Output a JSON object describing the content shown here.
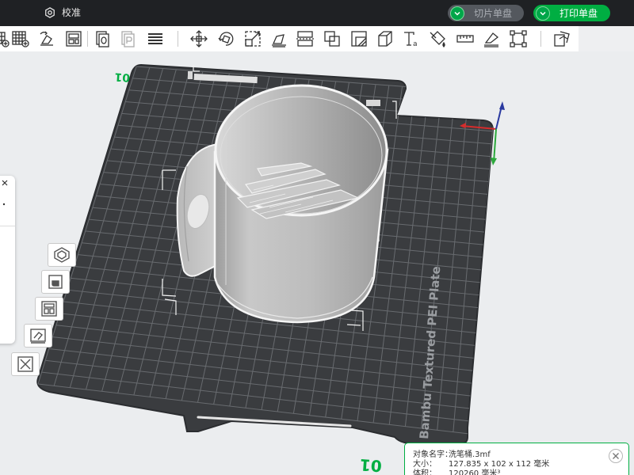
{
  "titlebar": {
    "tab_label": "校准",
    "slice_button": "切片单盘",
    "print_button": "打印单盘"
  },
  "toolbar": {
    "icons": [
      "add-object-icon",
      "add-plate-icon",
      "auto-orient-icon",
      "arrange-icon",
      "split-objects-icon",
      "split-parts-icon",
      "layers-icon",
      "move-icon",
      "rotate-icon",
      "scale-icon",
      "lay-on-face-icon",
      "cut-icon",
      "boolean-icon",
      "support-paint-icon",
      "measure-shape-icon",
      "text-icon",
      "color-paint-icon",
      "ruler-icon",
      "seam-paint-icon",
      "assembly-icon",
      "view-assembly-icon"
    ]
  },
  "viewport": {
    "plate_label": "Bambu Textured PEI Plate",
    "plate_number": "01",
    "plate_number_flipped": "01"
  },
  "left_tools": [
    "orient-icon",
    "slice-plate-icon",
    "arrange-plate-icon",
    "plate-settings-icon",
    "remove-plate-icon"
  ],
  "object_info": {
    "name_key": "对象名字：",
    "name_value": "洗笔桶.3mf",
    "size_key": "大小：",
    "size_value": "127.835 x 102 x 112 毫米",
    "volume_key": "体积：",
    "volume_value": "120260 毫米³"
  },
  "colors": {
    "brand_green": "#00ae42",
    "titlebar_bg": "#1f2124",
    "plate": "#3a3c3f",
    "grid": "#6b6e72",
    "model": "#c4c4c4"
  }
}
